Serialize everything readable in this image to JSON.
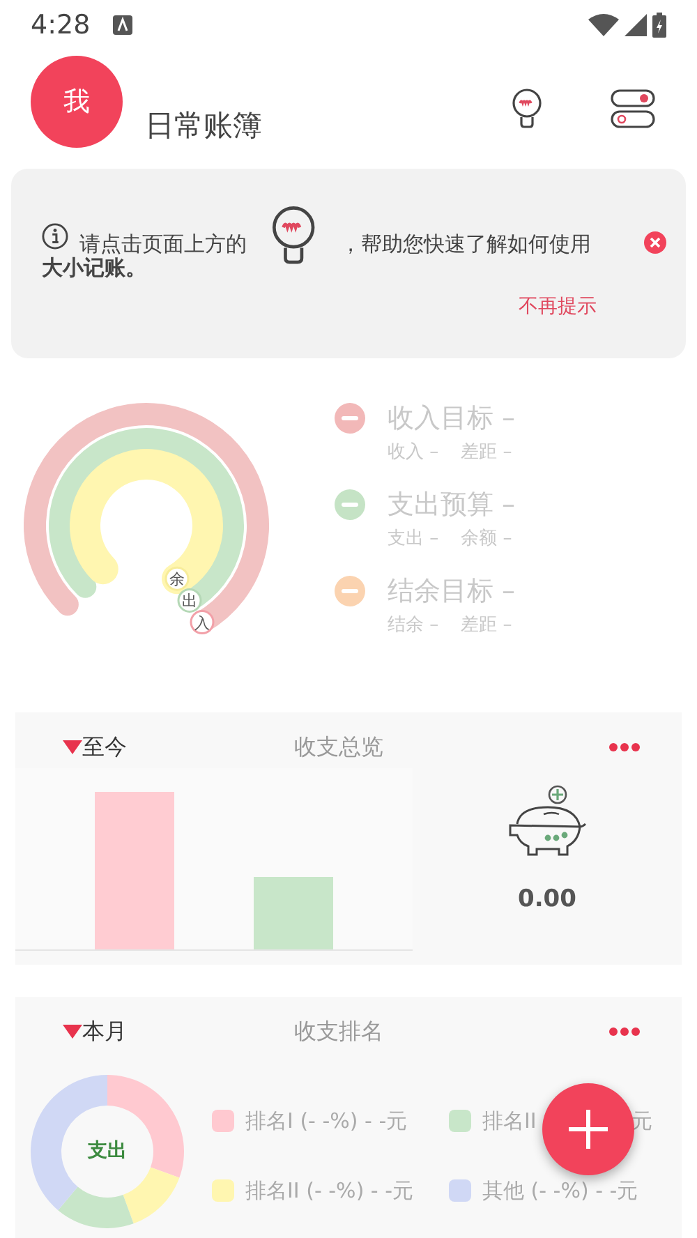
{
  "status_bar": {
    "time": "4:28"
  },
  "header": {
    "avatar": "我",
    "title": "日常账簿"
  },
  "tip": {
    "before": "请点击页面上方的",
    "after": "，帮助您快速了解如何使用",
    "bold_line": "大小记账。",
    "dismiss": "不再提示"
  },
  "gauge": {
    "ring_labels": [
      "余",
      "出",
      "入"
    ],
    "goals": [
      {
        "title": "收入目标 –",
        "detail_1": "收入 –",
        "detail_2": "差距 –",
        "color": "#f2b8b8"
      },
      {
        "title": "支出预算 –",
        "detail_1": "支出 –",
        "detail_2": "余额 –",
        "color": "#c5e3c5"
      },
      {
        "title": "结余目标 –",
        "detail_1": "结余 –",
        "detail_2": "差距 –",
        "color": "#fbd3b0"
      }
    ]
  },
  "overview": {
    "period": "至今",
    "title": "收支总览",
    "balance": "0.00"
  },
  "ranking": {
    "period": "本月",
    "title": "收支排名",
    "donut_label": "支出",
    "legend": [
      {
        "text": "排名I (- -%) - -元",
        "color": "#ffc9d0"
      },
      {
        "text": "排名II",
        "tail": "元",
        "color": "#c8e6c9"
      },
      {
        "text": "排名II (- -%) - -元",
        "color": "#fff6b0"
      },
      {
        "text": "其他 (- -%) - -元",
        "color": "#d0d8f5"
      }
    ]
  }
}
